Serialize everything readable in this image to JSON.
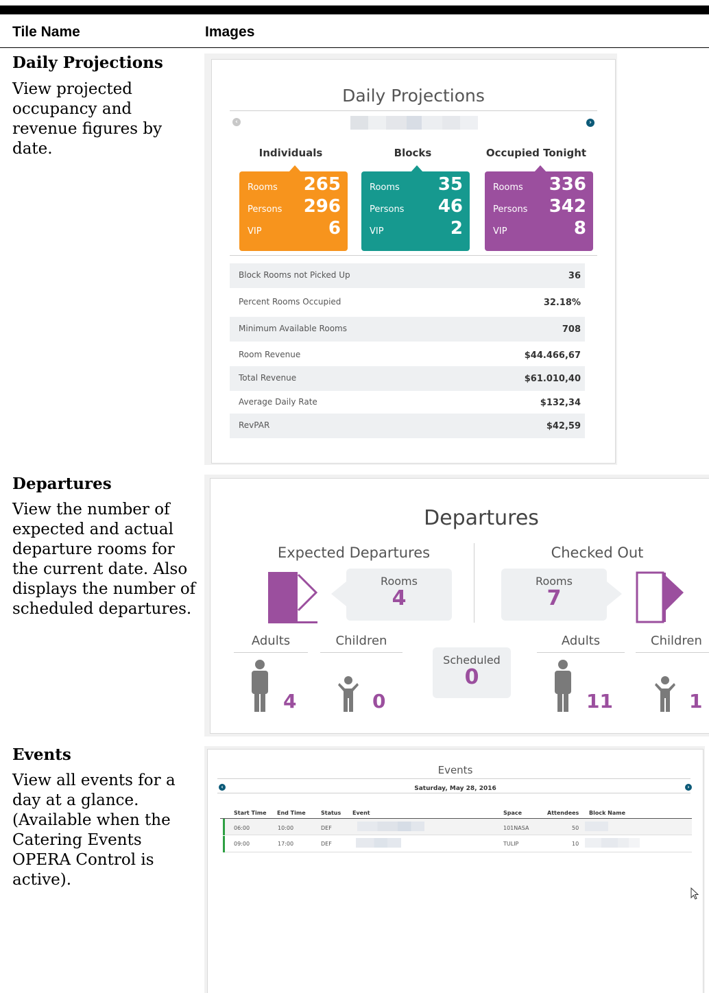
{
  "table_header": {
    "tile_name": "Tile Name",
    "images": "Images"
  },
  "rows": [
    {
      "title": "Daily Projections",
      "description": "View projected occupancy and revenue figures by date."
    },
    {
      "title": "Departures",
      "description": "View the number of expected and actual departure rooms for the current date. Also displays the number of scheduled departures."
    },
    {
      "title": "Events",
      "description": "View all events for a day at a glance. (Available when the Catering Events OPERA Control is active)."
    }
  ],
  "daily_projections": {
    "title": "Daily Projections",
    "groups": [
      {
        "label": "Individuals",
        "color": "#f7941d",
        "rooms_label": "Rooms",
        "rooms": "265",
        "persons_label": "Persons",
        "persons": "296",
        "vip_label": "VIP",
        "vip": "6"
      },
      {
        "label": "Blocks",
        "color": "#16998f",
        "rooms_label": "Rooms",
        "rooms": "35",
        "persons_label": "Persons",
        "persons": "46",
        "vip_label": "VIP",
        "vip": "2"
      },
      {
        "label": "Occupied Tonight",
        "color": "#9b4f9e",
        "rooms_label": "Rooms",
        "rooms": "336",
        "persons_label": "Persons",
        "persons": "342",
        "vip_label": "VIP",
        "vip": "8"
      }
    ],
    "metrics": [
      {
        "label": "Block Rooms not Picked Up",
        "value": "36"
      },
      {
        "label": "Percent Rooms Occupied",
        "value": "32.18%"
      },
      {
        "label": "Minimum Available Rooms",
        "value": "708"
      },
      {
        "label": "Room Revenue",
        "value": "$44.466,67"
      },
      {
        "label": "Total Revenue",
        "value": "$61.010,40"
      },
      {
        "label": "Average Daily Rate",
        "value": "$132,34"
      },
      {
        "label": "RevPAR",
        "value": "$42,59"
      }
    ]
  },
  "departures": {
    "title": "Departures",
    "expected": {
      "label": "Expected Departures",
      "rooms_label": "Rooms",
      "rooms": "4",
      "adults_label": "Adults",
      "adults": "4",
      "children_label": "Children",
      "children": "0"
    },
    "checked_out": {
      "label": "Checked Out",
      "rooms_label": "Rooms",
      "rooms": "7",
      "adults_label": "Adults",
      "adults": "11",
      "children_label": "Children",
      "children": "1"
    },
    "scheduled_label": "Scheduled",
    "scheduled": "0",
    "accent_color": "#9b4f9e"
  },
  "events": {
    "title": "Events",
    "date": "Saturday, May 28, 2016",
    "columns": [
      "Start Time",
      "End Time",
      "Status",
      "Event",
      "Space",
      "Attendees",
      "Block Name"
    ],
    "rows": [
      {
        "start": "06:00",
        "end": "10:00",
        "status": "DEF",
        "space": "101NASA",
        "attendees": "50"
      },
      {
        "start": "09:00",
        "end": "17:00",
        "status": "DEF",
        "space": "TULIP",
        "attendees": "10"
      }
    ],
    "status_color": "#2ea043"
  }
}
